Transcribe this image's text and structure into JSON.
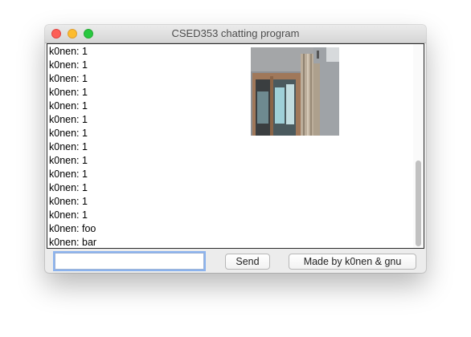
{
  "window": {
    "title": "CSED353 chatting program"
  },
  "chat": {
    "messages": [
      "k0nen: 1",
      "k0nen: 1",
      "k0nen: 1",
      "k0nen: 1",
      "k0nen: 1",
      "k0nen: 1",
      "k0nen: 1",
      "k0nen: 1",
      "k0nen: 1",
      "k0nen: 1",
      "k0nen: 1",
      "k0nen: 1",
      "k0nen: 1",
      "k0nen: foo",
      "k0nen: bar"
    ]
  },
  "input": {
    "value": "",
    "placeholder": ""
  },
  "buttons": {
    "send_label": "Send",
    "credits_label": "Made by k0nen & gnu"
  },
  "colors": {
    "close": "#fc5f57",
    "minimize": "#fdbc2e",
    "maximize": "#28c840",
    "focus_ring": "#8bb3ee"
  }
}
